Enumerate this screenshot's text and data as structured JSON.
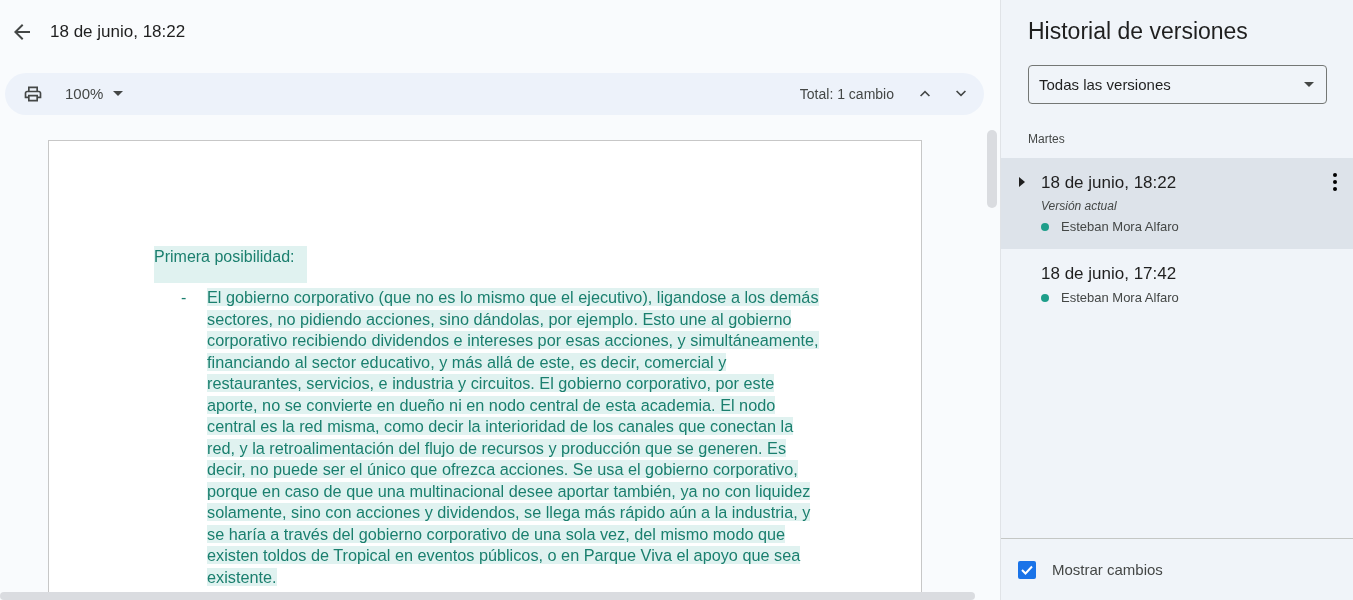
{
  "header": {
    "title": "18 de junio, 18:22"
  },
  "toolbar": {
    "zoom": "100%",
    "total": "Total: 1 cambio"
  },
  "document": {
    "heading": "Primera posibilidad:",
    "bullet": "-",
    "paragraph": "El gobierno corporativo (que no es lo mismo que el ejecutivo), ligandose a los demás sectores, no pidiendo acciones, sino dándolas, por ejemplo. Esto une al gobierno corporativo recibiendo dividendos e intereses por esas acciones, y simultáneamente, financiando al sector educativo, y más allá de este, es decir, comercial y restaurantes, servicios, e industria y circuitos. El gobierno corporativo, por este aporte, no se convierte en dueño ni en nodo central de esta academia. El nodo central es la red misma, como decir la interioridad de los canales que conectan la red, y la retroalimentación del flujo de recursos y producción que se generen. Es decir, no puede ser el único que ofrezca acciones. Se usa el gobierno corporativo, porque en caso de que una multinacional desee aportar también, ya no con liquidez solamente, sino con acciones y dividendos, se llega más rápido aún a la industria, y se haría a través del gobierno corporativo de una sola vez, del mismo modo que existen toldos de Tropical en eventos públicos, o en Parque Viva el apoyo que sea existente."
  },
  "sidebar": {
    "title": "Historial de versiones",
    "filter": "Todas las versiones",
    "group": "Martes",
    "versions": [
      {
        "title": "18 de junio, 18:22",
        "selected": true,
        "expandable": true,
        "note": "Versión actual",
        "author": "Esteban Mora Alfaro",
        "color": "#1e9e8a"
      },
      {
        "title": "18 de junio, 17:42",
        "selected": false,
        "expandable": false,
        "author": "Esteban Mora Alfaro",
        "color": "#1e9e8a"
      }
    ],
    "show_changes": {
      "label": "Mostrar cambios",
      "checked": true
    }
  }
}
